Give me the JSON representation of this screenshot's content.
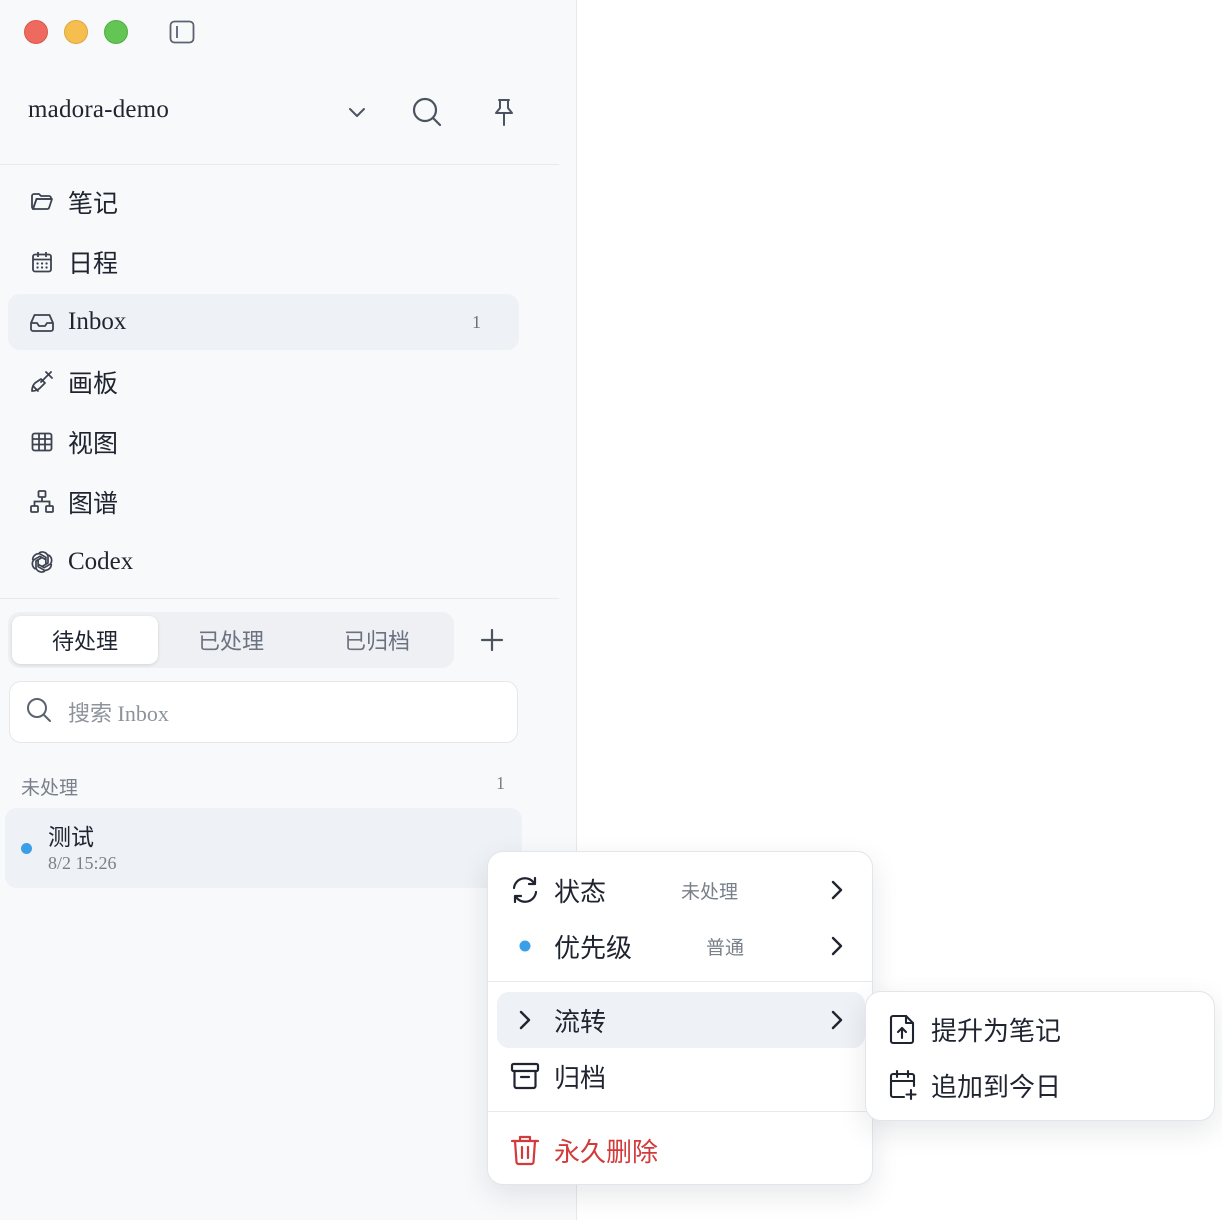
{
  "window": {
    "workspace_name": "madora-demo",
    "icons": {
      "toggle_sidebar": "sidebar-toggle-icon",
      "workspace_dropdown": "chevron-down-icon",
      "search": "search-icon",
      "pin": "pin-icon"
    }
  },
  "sidebar": {
    "nav_items": [
      {
        "label": "笔记",
        "icon": "folder-icon"
      },
      {
        "label": "日程",
        "icon": "calendar-icon"
      },
      {
        "label": "Inbox",
        "icon": "inbox-icon",
        "count": "1",
        "active": true
      },
      {
        "label": "画板",
        "icon": "brush-icon"
      },
      {
        "label": "视图",
        "icon": "table-icon"
      },
      {
        "label": "图谱",
        "icon": "graph-icon"
      },
      {
        "label": "Codex",
        "icon": "openai-icon"
      }
    ],
    "tabs": [
      {
        "label": "待处理",
        "active": true
      },
      {
        "label": "已处理"
      },
      {
        "label": "已归档"
      }
    ],
    "add_icon": "plus-icon",
    "search": {
      "placeholder": "搜索 Inbox",
      "value": ""
    },
    "group": {
      "label": "未处理",
      "count": "1"
    },
    "entries": [
      {
        "title": "测试",
        "time": "8/2 15:26",
        "priority_color": "#3b9fe8"
      }
    ]
  },
  "context_menu": {
    "items": [
      {
        "label": "状态",
        "value": "未处理",
        "icon": "refresh-icon"
      },
      {
        "label": "优先级",
        "value": "普通",
        "icon": "priority-dot-icon"
      },
      {
        "label": "流转",
        "icon": "chevron-right-icon",
        "hover": true
      },
      {
        "label": "归档",
        "icon": "archive-icon"
      },
      {
        "label": "永久删除",
        "icon": "trash-icon",
        "danger": true
      }
    ],
    "submenu": [
      {
        "label": "提升为笔记",
        "icon": "file-upload-icon"
      },
      {
        "label": "追加到今日",
        "icon": "calendar-plus-icon"
      }
    ]
  },
  "colors": {
    "accent_dot": "#3b9fe8",
    "danger": "#d33a3a",
    "sidebar_bg": "#f8f9fb",
    "active_bg": "#eef1f5"
  }
}
